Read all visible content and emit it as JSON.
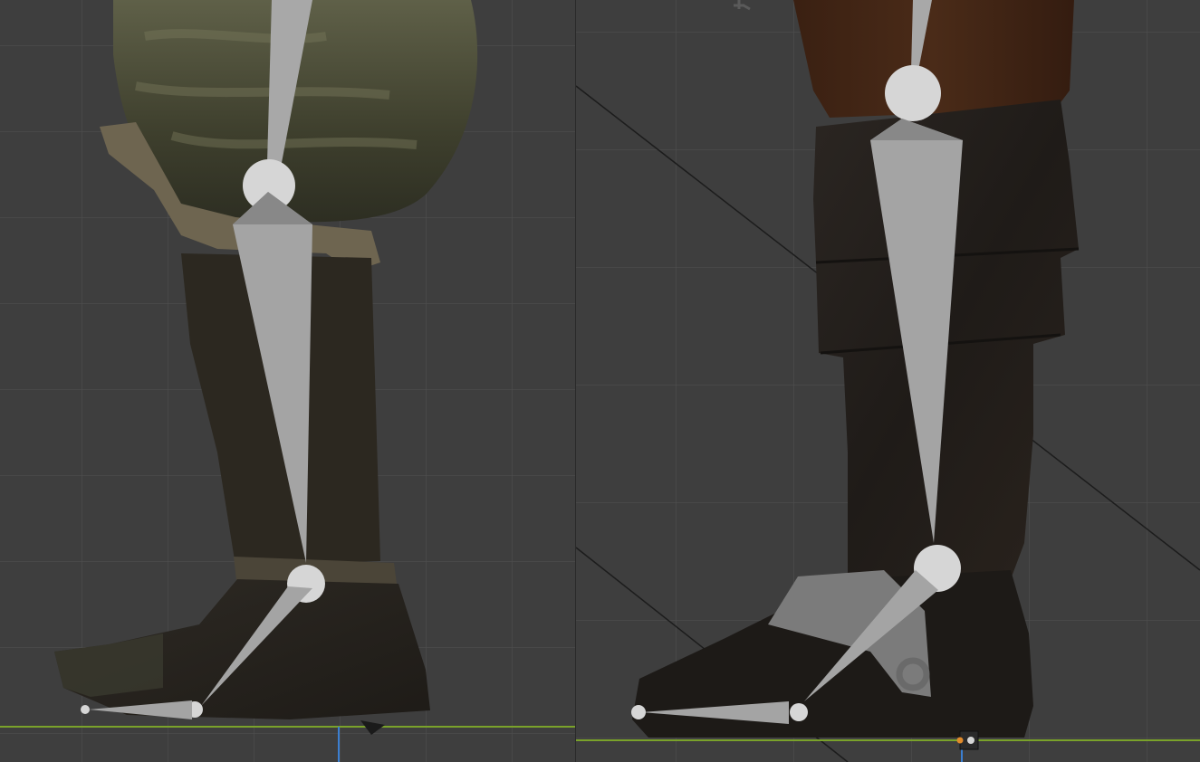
{
  "app": {
    "label": ""
  },
  "viewports": [
    {
      "id": "left",
      "name": "",
      "header_text": ""
    },
    {
      "id": "right",
      "name": "",
      "header_text": ""
    }
  ],
  "colors": {
    "grid_bg": "#3e3e3e",
    "grid_line": "#505050",
    "ground_axis": "#7aa22a",
    "z_axis": "#3b7fd1",
    "bone": "#a8a8a8",
    "bone_joint": "#d8d8d8"
  },
  "icons": [
    "origin-icon",
    "empty-cursor-icon"
  ]
}
